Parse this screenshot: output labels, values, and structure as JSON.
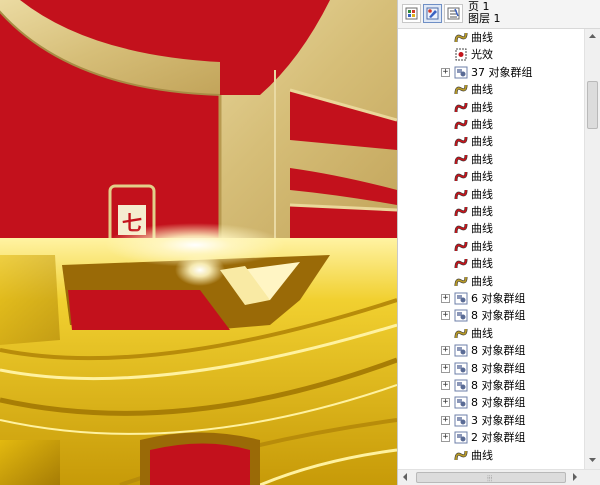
{
  "canvas": {
    "seal_char": "七",
    "colors": {
      "red": "#c3111c",
      "gold": "#d9c27a",
      "yellow": "#e6c21a"
    }
  },
  "toolbar": {
    "buttons": [
      {
        "icon": "show-object-properties-icon",
        "active": false
      },
      {
        "icon": "edit-across-layers-icon",
        "active": true
      },
      {
        "icon": "layer-manager-view-icon",
        "active": false
      }
    ]
  },
  "breadcrumb": {
    "page": "页 1",
    "layer": "图层 1"
  },
  "tree": {
    "rows": [
      {
        "label": "曲线",
        "type": "curve",
        "icon": "curve-gold-icon",
        "expandable": false
      },
      {
        "label": "光效",
        "type": "effect",
        "icon": "lens-effect-icon",
        "expandable": false
      },
      {
        "label": "37 对象群组",
        "type": "group",
        "icon": "group-icon",
        "expandable": true
      },
      {
        "label": "曲线",
        "type": "curve",
        "icon": "curve-gold-icon",
        "expandable": false
      },
      {
        "label": "曲线",
        "type": "curve",
        "icon": "curve-red-icon",
        "expandable": false
      },
      {
        "label": "曲线",
        "type": "curve",
        "icon": "curve-red-icon",
        "expandable": false
      },
      {
        "label": "曲线",
        "type": "curve",
        "icon": "curve-red-icon",
        "expandable": false
      },
      {
        "label": "曲线",
        "type": "curve",
        "icon": "curve-red-icon",
        "expandable": false
      },
      {
        "label": "曲线",
        "type": "curve",
        "icon": "curve-red-icon",
        "expandable": false
      },
      {
        "label": "曲线",
        "type": "curve",
        "icon": "curve-red-icon",
        "expandable": false
      },
      {
        "label": "曲线",
        "type": "curve",
        "icon": "curve-red-icon",
        "expandable": false
      },
      {
        "label": "曲线",
        "type": "curve",
        "icon": "curve-red-icon",
        "expandable": false
      },
      {
        "label": "曲线",
        "type": "curve",
        "icon": "curve-red-icon",
        "expandable": false
      },
      {
        "label": "曲线",
        "type": "curve",
        "icon": "curve-red-icon",
        "expandable": false
      },
      {
        "label": "曲线",
        "type": "curve",
        "icon": "curve-gold-icon",
        "expandable": false
      },
      {
        "label": "6 对象群组",
        "type": "group",
        "icon": "group-icon",
        "expandable": true
      },
      {
        "label": "8 对象群组",
        "type": "group",
        "icon": "group-icon",
        "expandable": true
      },
      {
        "label": "曲线",
        "type": "curve",
        "icon": "curve-gold-icon",
        "expandable": false
      },
      {
        "label": "8 对象群组",
        "type": "group",
        "icon": "group-icon",
        "expandable": true
      },
      {
        "label": "8 对象群组",
        "type": "group",
        "icon": "group-icon",
        "expandable": true
      },
      {
        "label": "8 对象群组",
        "type": "group",
        "icon": "group-icon",
        "expandable": true
      },
      {
        "label": "8 对象群组",
        "type": "group",
        "icon": "group-icon",
        "expandable": true
      },
      {
        "label": "3 对象群组",
        "type": "group",
        "icon": "group-icon",
        "expandable": true
      },
      {
        "label": "2 对象群组",
        "type": "group",
        "icon": "group-icon",
        "expandable": true
      },
      {
        "label": "曲线",
        "type": "curve",
        "icon": "curve-gold-icon",
        "expandable": false
      }
    ],
    "expand_symbol": "+",
    "icon_colors": {
      "curve-gold": "#b89a2a",
      "curve-red": "#c4151c",
      "group": "#6d7fa8"
    }
  },
  "scrollbar": {
    "grip": "⦙⦙⦙"
  }
}
